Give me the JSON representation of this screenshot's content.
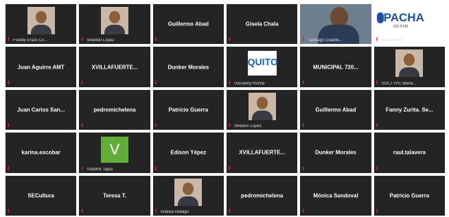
{
  "tiles": [
    {
      "type": "photo",
      "caption": "Freddy Erazo Co..."
    },
    {
      "type": "photo",
      "caption": "Sheldon López"
    },
    {
      "type": "name",
      "label": "Guillermo Abad"
    },
    {
      "type": "name",
      "label": "Gisela Chala"
    },
    {
      "type": "video",
      "caption": "Santiago Guarde..."
    },
    {
      "type": "pacha",
      "logo": "PACHA",
      "sub": "102.9 FM",
      "caption": "PACHA FM"
    },
    {
      "type": "name",
      "label": "Juan Aguirre AMT"
    },
    {
      "type": "name",
      "label": "XVILLAFUERTE..."
    },
    {
      "type": "name",
      "label": "Dunker Morales"
    },
    {
      "type": "quito",
      "logo": "QUITO",
      "caption": "Giovanny Rocha"
    },
    {
      "type": "name",
      "label": "MUNICIPAL 720..."
    },
    {
      "type": "photo",
      "caption": "SOCTYPC Maria..."
    },
    {
      "type": "name",
      "label": "Juan Carlos San..."
    },
    {
      "type": "name",
      "label": "pedromichelena"
    },
    {
      "type": "name",
      "label": "Patricio Guerra"
    },
    {
      "type": "photo",
      "caption": "Sheldon López"
    },
    {
      "type": "name",
      "label": "Guillermo Abad"
    },
    {
      "type": "name",
      "label": "Fanny Zurita. Se..."
    },
    {
      "type": "name",
      "label": "karina.escobar"
    },
    {
      "type": "v",
      "letter": "V",
      "caption": "Vladimir Tapia"
    },
    {
      "type": "name",
      "label": "Edison Yépez"
    },
    {
      "type": "name",
      "label": "XVILLAFUERTE..."
    },
    {
      "type": "name",
      "label": "Dunker Morales"
    },
    {
      "type": "name",
      "label": "raul.talavera"
    },
    {
      "type": "name",
      "label": "SECultura"
    },
    {
      "type": "name",
      "label": "Teresa T."
    },
    {
      "type": "photo",
      "caption": "Andrea Hidalgo"
    },
    {
      "type": "name",
      "label": "pedromichelena"
    },
    {
      "type": "name",
      "label": "Mónica Sandoval"
    },
    {
      "type": "name",
      "label": "Patricio Guerra"
    }
  ],
  "mic_glyph": "ɫ"
}
